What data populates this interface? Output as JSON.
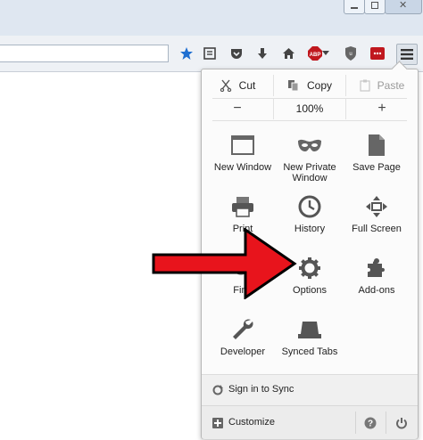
{
  "edit_row": {
    "cut": "Cut",
    "copy": "Copy",
    "paste": "Paste"
  },
  "zoom_row": {
    "minus": "−",
    "level": "100%",
    "plus": "+"
  },
  "tiles": [
    {
      "label": "New Window",
      "icon": "new-window-icon"
    },
    {
      "label": "New Private Window",
      "icon": "private-mask-icon"
    },
    {
      "label": "Save Page",
      "icon": "save-page-icon"
    },
    {
      "label": "Print",
      "icon": "printer-icon"
    },
    {
      "label": "History",
      "icon": "history-clock-icon"
    },
    {
      "label": "Full Screen",
      "icon": "fullscreen-icon"
    },
    {
      "label": "Find",
      "icon": "find-icon"
    },
    {
      "label": "Options",
      "icon": "gear-icon"
    },
    {
      "label": "Add-ons",
      "icon": "puzzle-icon"
    },
    {
      "label": "Developer",
      "icon": "wrench-icon"
    },
    {
      "label": "Synced Tabs",
      "icon": "synced-tabs-icon"
    }
  ],
  "footer": {
    "sync": "Sign in to Sync",
    "customize": "Customize"
  },
  "toolbar_icons": [
    "bookmark-star-icon",
    "reading-list-icon",
    "pocket-icon",
    "download-icon",
    "home-icon",
    "adblock-icon",
    "ublock-icon",
    "extension-icon",
    "hamburger-menu-icon"
  ],
  "colors": {
    "arrow": "#e8141c",
    "accent_blue": "#1f6fd1",
    "abp_red": "#c0181e"
  }
}
